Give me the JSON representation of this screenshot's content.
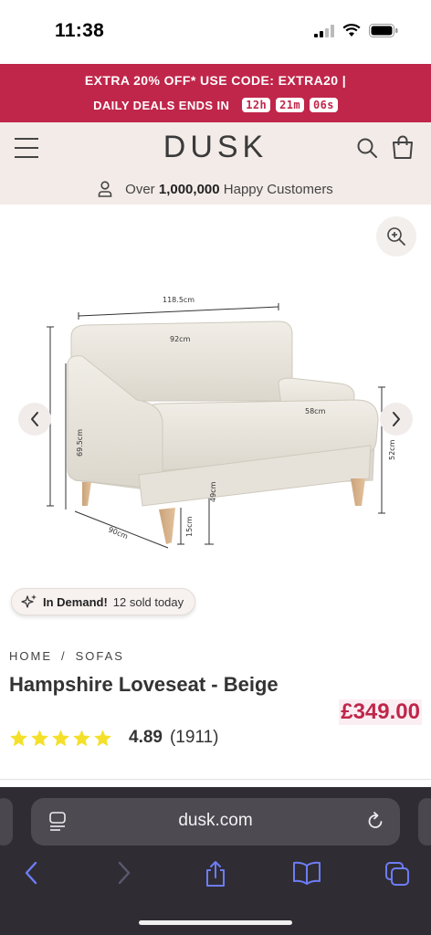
{
  "status_bar": {
    "time": "11:38"
  },
  "promo": {
    "line1": "EXTRA 20% OFF* USE CODE: EXTRA20 |",
    "deals_label": "DAILY DEALS ENDS IN",
    "hours": "12h",
    "minutes": "21m",
    "seconds": "06s",
    "bg_color": "#c0264a"
  },
  "header": {
    "logo": "DUSK"
  },
  "customers": {
    "prefix": "Over",
    "count": "1,000,000",
    "suffix": "Happy Customers"
  },
  "gallery": {
    "badge_strong": "In Demand!",
    "badge_text": "12 sold today",
    "dimensions": {
      "overall_width": "118.5cm",
      "seat_width": "92cm",
      "seat_depth": "58cm",
      "overall_height": "69.5cm",
      "seat_height": "49cm",
      "arm_height": "52cm",
      "leg_height": "15cm",
      "depth": "90cm"
    }
  },
  "product": {
    "breadcrumb": [
      "HOME",
      "/",
      "SOFAS"
    ],
    "title": "Hampshire Loveseat - Beige",
    "price": "£349.00",
    "rating": "4.89",
    "review_count": "(1911)",
    "stars": 5,
    "star_color": "#f4e02a",
    "price_color": "#c0264a"
  },
  "browser": {
    "url": "dusk.com"
  }
}
